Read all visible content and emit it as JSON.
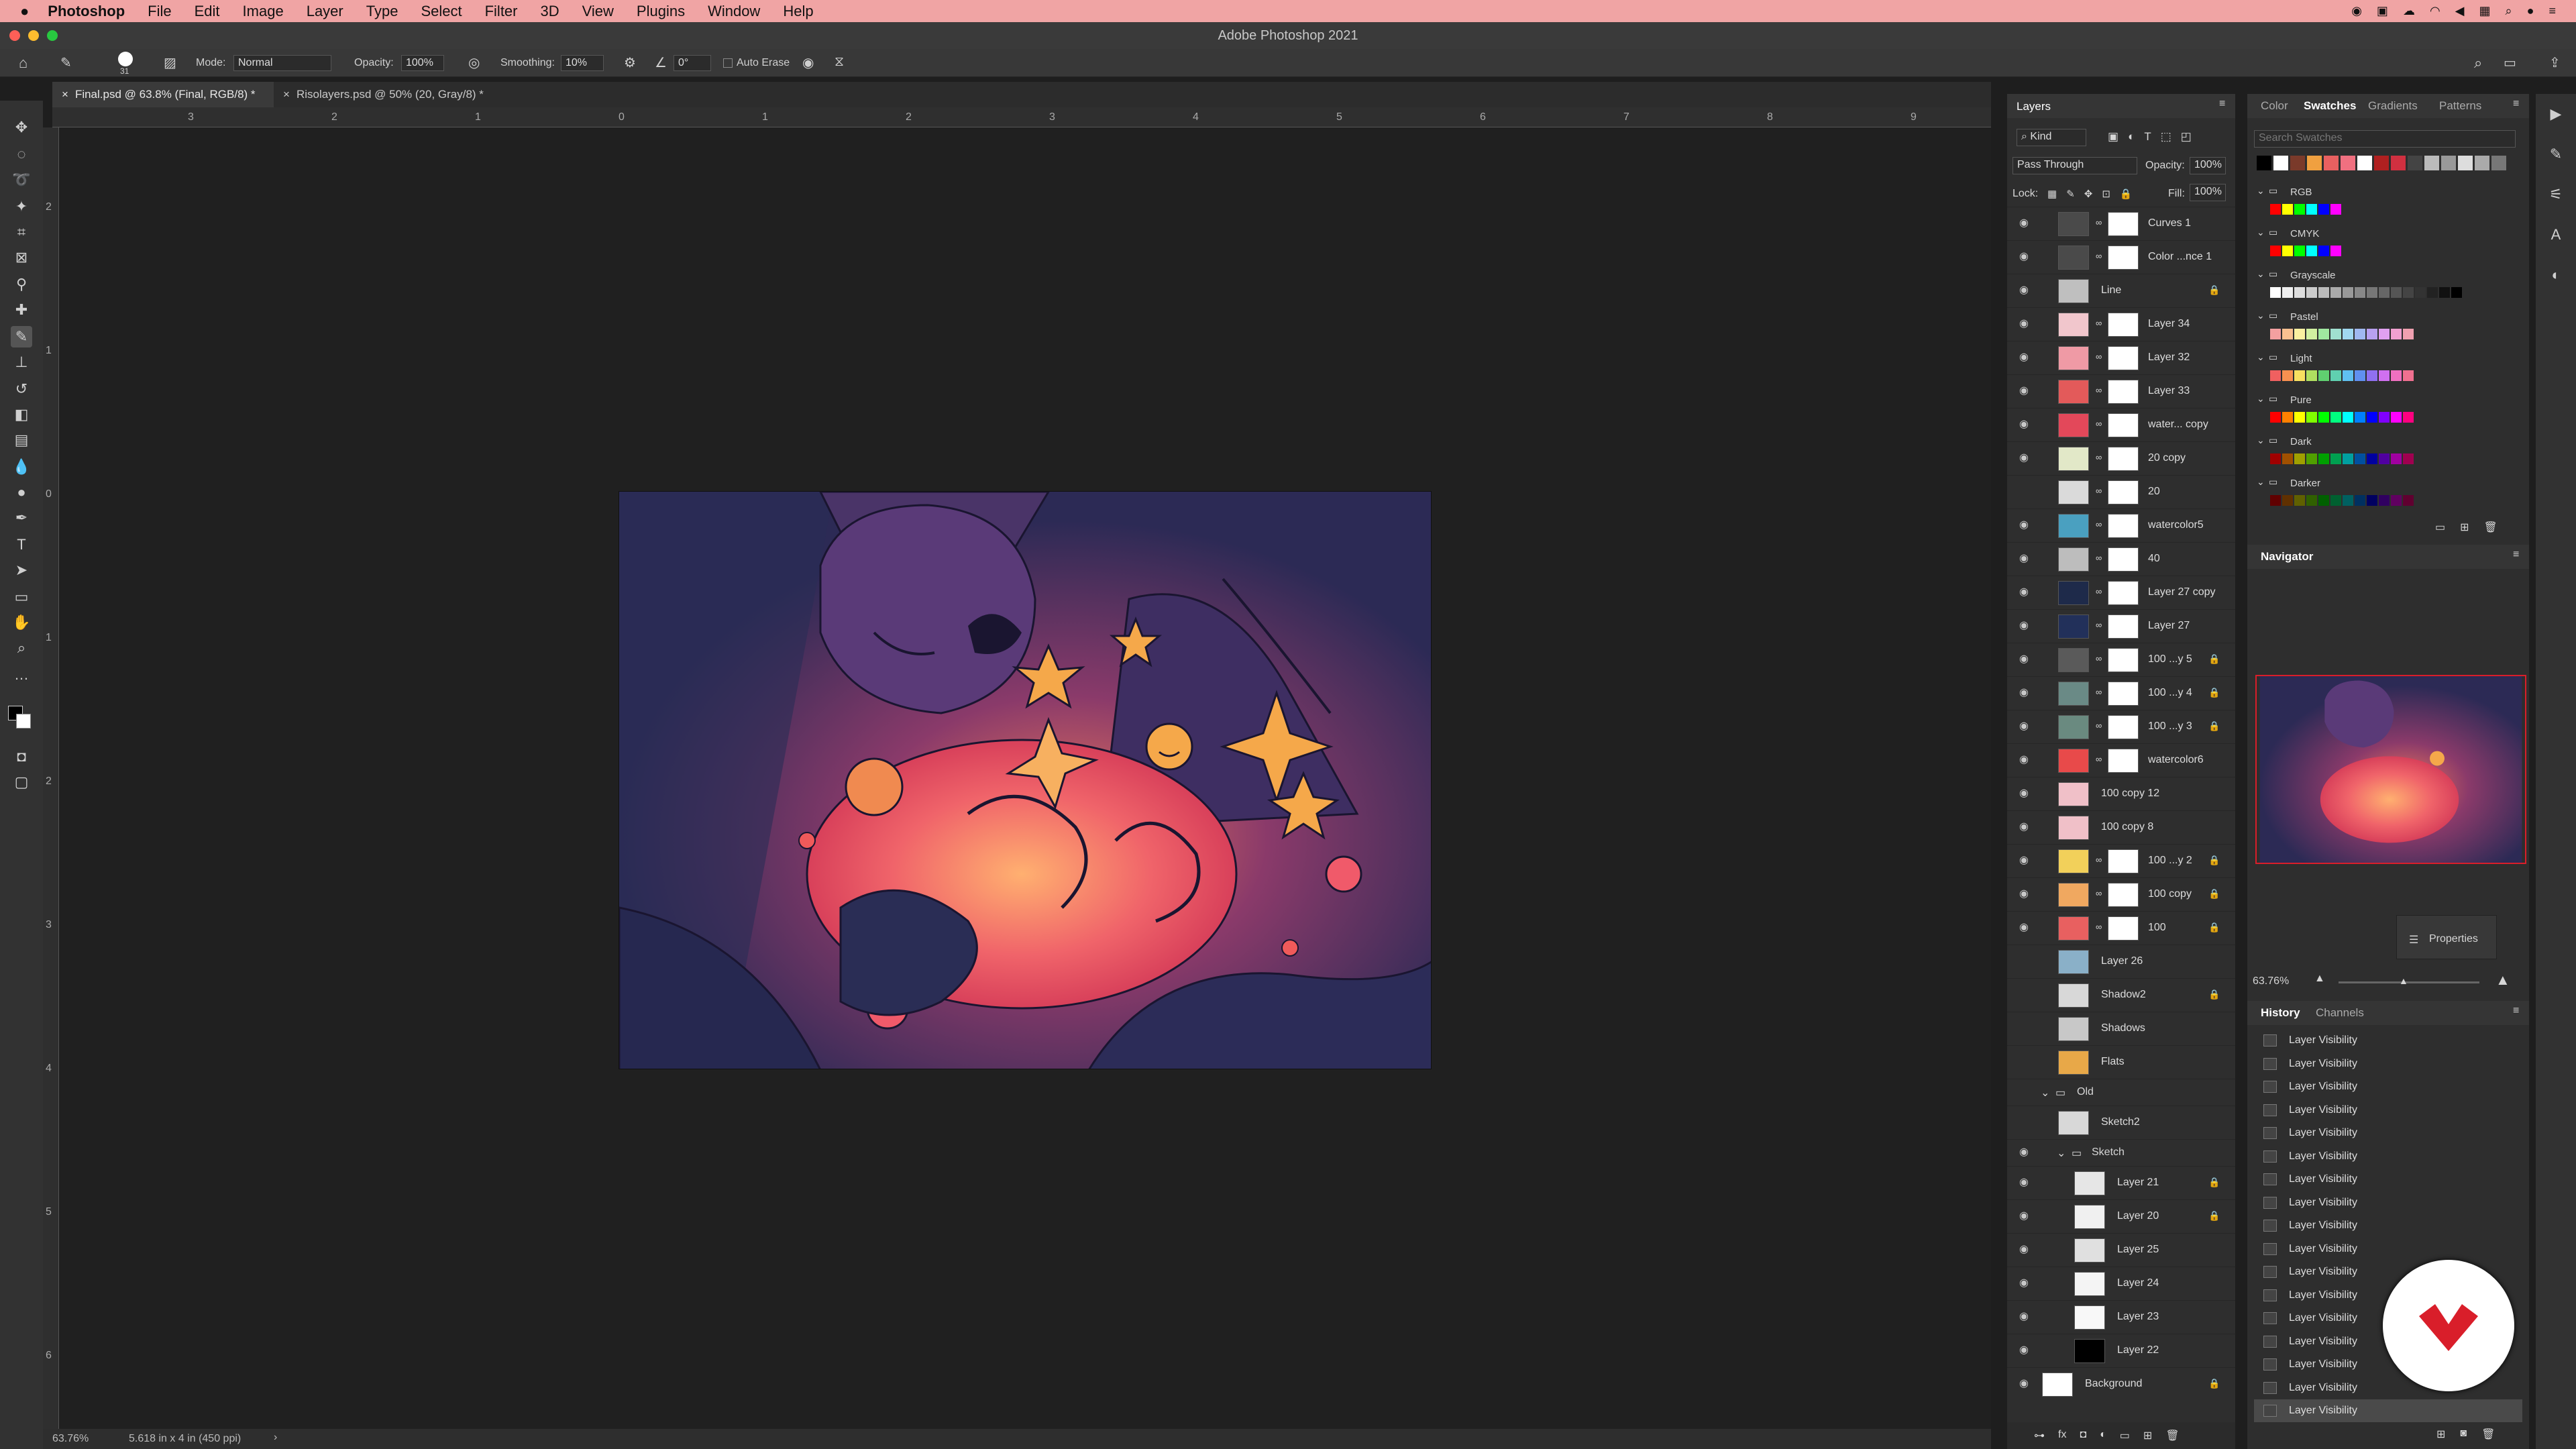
{
  "menubar": {
    "app": "Photoshop",
    "items": [
      "File",
      "Edit",
      "Image",
      "Layer",
      "Type",
      "Select",
      "Filter",
      "3D",
      "View",
      "Plugins",
      "Window",
      "Help"
    ]
  },
  "window": {
    "title": "Adobe Photoshop 2021"
  },
  "options": {
    "brush_size": "31",
    "mode_label": "Mode:",
    "mode_value": "Normal",
    "opacity_label": "Opacity:",
    "opacity_value": "100%",
    "smoothing_label": "Smoothing:",
    "smoothing_value": "10%",
    "angle_value": "0°",
    "auto_erase": "Auto Erase"
  },
  "tabs": [
    {
      "label": "Final.psd @ 63.8% (Final, RGB/8) *",
      "active": true
    },
    {
      "label": "Risolayers.psd @ 50% (20, Gray/8) *",
      "active": false
    }
  ],
  "ruler_h": [
    "3",
    "2",
    "1",
    "0",
    "1",
    "2",
    "3",
    "4",
    "5",
    "6",
    "7",
    "8",
    "9"
  ],
  "ruler_v": [
    "2",
    "1",
    "0",
    "1",
    "2",
    "3",
    "4",
    "5",
    "6"
  ],
  "status": {
    "zoom": "63.76%",
    "docinfo": "5.618 in x 4 in (450 ppi)"
  },
  "layers_panel": {
    "title": "Layers",
    "kind": "Kind",
    "blend": "Pass Through",
    "opacity_label": "Opacity:",
    "opacity": "100%",
    "lock_label": "Lock:",
    "fill_label": "Fill:",
    "fill": "100%",
    "layers": [
      {
        "name": "Curves 1",
        "visible": true,
        "thumb": "#4a4a4a",
        "mask": true,
        "lock": false
      },
      {
        "name": "Color ...nce 1",
        "visible": true,
        "thumb": "#4a4a4a",
        "mask": true,
        "lock": false
      },
      {
        "name": "Line",
        "visible": true,
        "thumb": "#bfbfbf",
        "mask": false,
        "lock": true
      },
      {
        "name": "Layer 34",
        "visible": true,
        "thumb": "#f1c6cc",
        "mask": true,
        "lock": false
      },
      {
        "name": "Layer 32",
        "visible": true,
        "thumb": "#ef9aa5",
        "mask": true,
        "lock": false
      },
      {
        "name": "Layer 33",
        "visible": true,
        "thumb": "#e35a5a",
        "mask": true,
        "lock": false
      },
      {
        "name": "water... copy",
        "visible": true,
        "thumb": "#e3485a",
        "mask": true,
        "lock": false
      },
      {
        "name": "20 copy",
        "visible": true,
        "thumb": "#e2e8c8",
        "mask": true,
        "lock": false
      },
      {
        "name": "20",
        "visible": false,
        "thumb": "#dadada",
        "mask": true,
        "lock": false
      },
      {
        "name": "watercolor5",
        "visible": true,
        "thumb": "#4aa0c0",
        "mask": true,
        "lock": false
      },
      {
        "name": "40",
        "visible": true,
        "thumb": "#bdbdbd",
        "mask": true,
        "lock": false
      },
      {
        "name": "Layer 27 copy",
        "visible": true,
        "thumb": "#1e2a4a",
        "mask": true,
        "lock": false
      },
      {
        "name": "Layer 27",
        "visible": true,
        "thumb": "#22305a",
        "mask": true,
        "lock": false
      },
      {
        "name": "100 ...y 5",
        "visible": true,
        "thumb": "#5a5a5a",
        "mask": true,
        "lock": true
      },
      {
        "name": "100 ...y 4",
        "visible": true,
        "thumb": "#6a8a86",
        "mask": true,
        "lock": true
      },
      {
        "name": "100 ...y 3",
        "visible": true,
        "thumb": "#6a8a80",
        "mask": true,
        "lock": true
      },
      {
        "name": "watercolor6",
        "visible": true,
        "thumb": "#e84a4a",
        "mask": true,
        "lock": false
      },
      {
        "name": "100 copy 12",
        "visible": true,
        "thumb": "#f0c0c8",
        "mask": false,
        "lock": false
      },
      {
        "name": "100 copy 8",
        "visible": true,
        "thumb": "#f0c0c8",
        "mask": false,
        "lock": false
      },
      {
        "name": "100 ...y 2",
        "visible": true,
        "thumb": "#f2d05a",
        "mask": true,
        "lock": true
      },
      {
        "name": "100 copy",
        "visible": true,
        "thumb": "#f0a860",
        "mask": true,
        "lock": true
      },
      {
        "name": "100",
        "visible": true,
        "thumb": "#e86060",
        "mask": true,
        "lock": true
      },
      {
        "name": "Layer 26",
        "visible": false,
        "thumb": "#8ab0c8",
        "mask": false,
        "lock": false
      },
      {
        "name": "Shadow2",
        "visible": false,
        "thumb": "#d8d8d8",
        "mask": false,
        "lock": true
      },
      {
        "name": "Shadows",
        "visible": false,
        "thumb": "#c8c8c8",
        "mask": false,
        "lock": false
      },
      {
        "name": "Flats",
        "visible": false,
        "thumb": "#e8a848",
        "mask": false,
        "lock": false
      }
    ],
    "group_old": "Old",
    "sketch2": "Sketch2",
    "group_sketch": "Sketch",
    "sketch_layers": [
      {
        "name": "Layer 21",
        "visible": true,
        "lock": true,
        "thumb": "#e6e6e6"
      },
      {
        "name": "Layer 20",
        "visible": true,
        "lock": true,
        "thumb": "#f0f0f0"
      },
      {
        "name": "Layer 25",
        "visible": true,
        "lock": false,
        "thumb": "#e0e0e0"
      },
      {
        "name": "Layer 24",
        "visible": true,
        "lock": false,
        "thumb": "#f4f4f4"
      },
      {
        "name": "Layer 23",
        "visible": true,
        "lock": false,
        "thumb": "#f8f8f8"
      },
      {
        "name": "Layer 22",
        "visible": true,
        "lock": false,
        "thumb": "#000000"
      }
    ],
    "background": "Background"
  },
  "swatches_panel": {
    "tabs": [
      "Color",
      "Swatches",
      "Gradients",
      "Patterns"
    ],
    "active": "Swatches",
    "search_placeholder": "Search Swatches",
    "groups": [
      "RGB",
      "CMYK",
      "Grayscale",
      "Pastel",
      "Light",
      "Pure",
      "Dark",
      "Darker"
    ]
  },
  "navigator": {
    "title": "Navigator",
    "zoom": "63.76%"
  },
  "properties": {
    "label": "Properties"
  },
  "history_panel": {
    "tabs": [
      "History",
      "Channels"
    ],
    "items": [
      "Layer Visibility",
      "Layer Visibility",
      "Layer Visibility",
      "Layer Visibility",
      "Layer Visibility",
      "Layer Visibility",
      "Layer Visibility",
      "Layer Visibility",
      "Layer Visibility",
      "Layer Visibility",
      "Layer Visibility",
      "Layer Visibility",
      "Layer Visibility",
      "Layer Visibility",
      "Layer Visibility",
      "Layer Visibility",
      "Layer Visibility"
    ]
  },
  "colors": {
    "menubar_bg": "#f0a4a4",
    "accent_red": "#d91e2a"
  }
}
